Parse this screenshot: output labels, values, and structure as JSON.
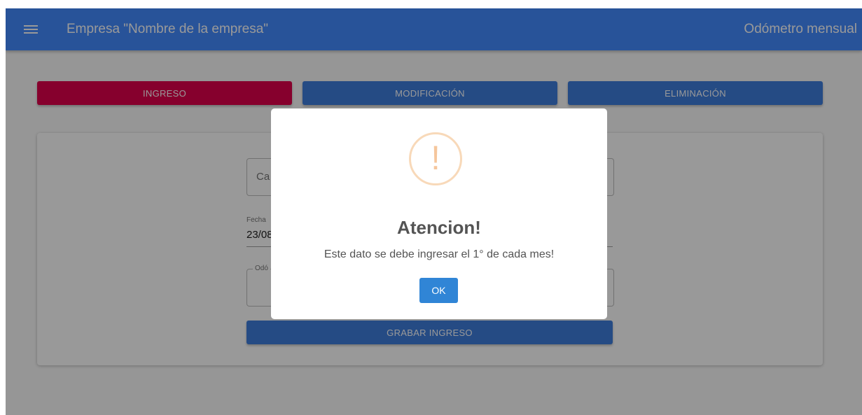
{
  "colors": {
    "appbar": "#448aff",
    "ingreso_button": "#e0004b",
    "secondary_buttons": "#3f7ddc",
    "save_button": "#3f7ddc",
    "ok_button": "#3085d6",
    "warning": "#f8bb86"
  },
  "appbar": {
    "menu_icon": "hamburger-menu-icon",
    "title": "Empresa \"Nombre de la empresa\"",
    "right_title": "Odómetro mensual"
  },
  "tabs": {
    "ingreso": "INGRESO",
    "modificacion": "MODIFICACIÓN",
    "eliminacion": "ELIMINACIÓN"
  },
  "form": {
    "field1_partial": "Ca",
    "date_label_partial": "Fecha",
    "date_value_partial": "23/08",
    "odometer_legend_partial": "Odó",
    "save_label": "GRABAR INGRESO"
  },
  "dialog": {
    "icon": "warning-icon",
    "icon_glyph": "!",
    "title": "Atencion!",
    "message": "Este dato se debe ingresar el 1° de cada mes!",
    "ok_label": "OK"
  }
}
